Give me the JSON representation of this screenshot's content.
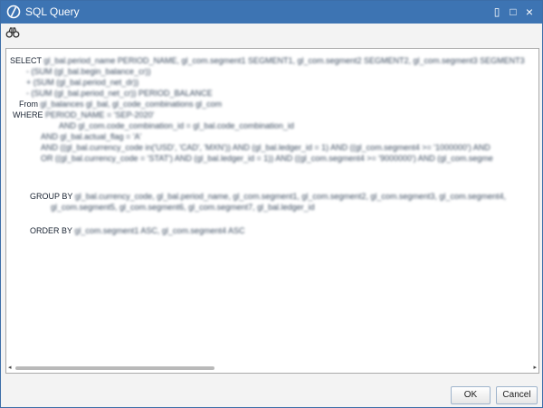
{
  "window": {
    "title": "SQL Query",
    "restore_symbol": "▯",
    "maximize_symbol": "□",
    "close_symbol": "×",
    "titlebar_color": "#3d74b3"
  },
  "toolbar": {
    "icon": "binoculars-icon",
    "glyph": "∂∂"
  },
  "sql": {
    "lines": [
      {
        "kw": "SELECT",
        "text": "gl_bal.period_name PERIOD_NAME, gl_com.segment1 SEGMENT1, gl_com.segment2 SEGMENT2, gl_com.segment3 SEGMENT3"
      },
      {
        "kw": "",
        "text": "- (SUM (gl_bal.begin_balance_cr))"
      },
      {
        "kw": "",
        "text": "+ (SUM (gl_bal.period_net_dr))"
      },
      {
        "kw": "",
        "text": "- (SUM (gl_bal.period_net_cr)) PERIOD_BALANCE"
      },
      {
        "kw": "From",
        "text": "gl_balances gl_bal, gl_code_combinations gl_com"
      },
      {
        "kw": "WHERE",
        "text": "PERIOD_NAME = 'SEP-2020'"
      },
      {
        "kw": "",
        "text": "AND       gl_com.code_combination_id = gl_bal.code_combination_id"
      },
      {
        "kw": "",
        "text": "AND gl_bal.actual_flag = 'A'"
      },
      {
        "kw": "",
        "text": "AND ((gl_bal.currency_code in('USD', 'CAD', 'MXN')) AND (gl_bal.ledger_id = 1) AND ((gl_com.segment4 >= '1000000') AND"
      },
      {
        "kw": "",
        "text": "OR ((gl_bal.currency_code = 'STAT') AND (gl_bal.ledger_id = 1)) AND ((gl_com.segment4 >= '9000000') AND (gl_com.segme"
      },
      {
        "kw": "GROUP BY",
        "text": "gl_bal.currency_code, gl_bal.period_name, gl_com.segment1, gl_com.segment2, gl_com.segment3, gl_com.segment4,"
      },
      {
        "kw": "",
        "text": "gl_com.segment5, gl_com.segment6, gl_com.segment7, gl_bal.ledger_id"
      },
      {
        "kw": "ORDER BY",
        "text": "gl_com.segment1 ASC, gl_com.segment4 ASC"
      }
    ]
  },
  "buttons": {
    "ok": "OK",
    "cancel": "Cancel"
  }
}
